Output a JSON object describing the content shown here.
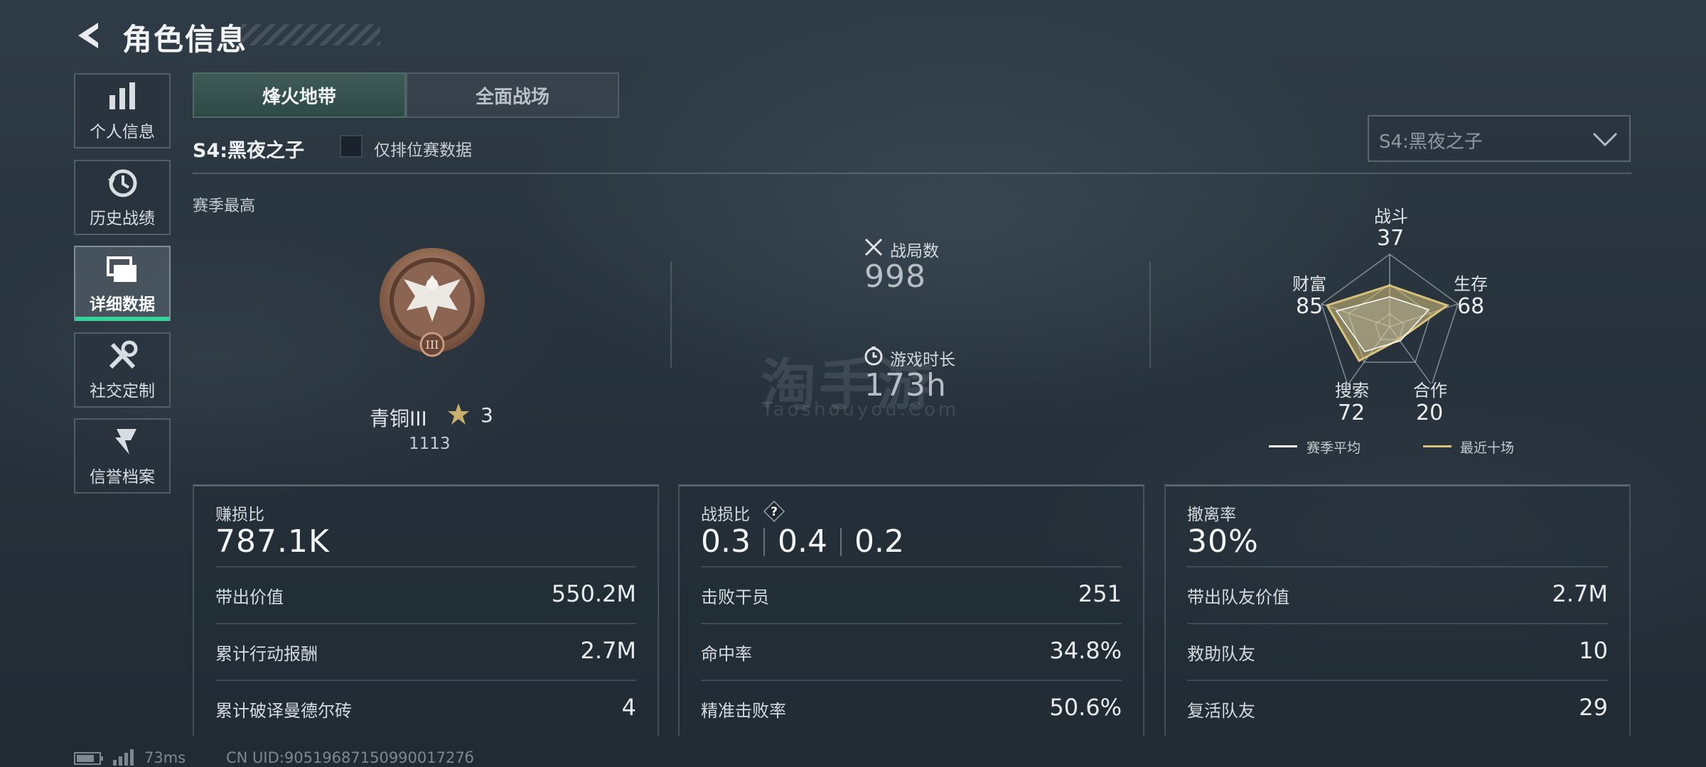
{
  "header": {
    "title": "角色信息"
  },
  "sidebar": {
    "items": [
      {
        "label": "个人信息",
        "icon": "bar-chart-icon"
      },
      {
        "label": "历史战绩",
        "icon": "history-clock-icon"
      },
      {
        "label": "详细数据",
        "icon": "detail-cards-icon",
        "active": true
      },
      {
        "label": "社交定制",
        "icon": "tools-icon"
      },
      {
        "label": "信誉档案",
        "icon": "shield-lightning-icon"
      }
    ]
  },
  "tabs": [
    {
      "label": "烽火地带",
      "active": true
    },
    {
      "label": "全面战场"
    }
  ],
  "season": {
    "name": "S4:黑夜之子",
    "ranked_only_label": "仅排位赛数据",
    "ranked_only_checked": false,
    "dropdown_value": "S4:黑夜之子",
    "best_label": "赛季最高"
  },
  "rank": {
    "name": "青铜III",
    "stars": "3",
    "score": "1113",
    "badge_numeral": "III"
  },
  "stats": {
    "matches_label": "战局数",
    "matches_value": "998",
    "playtime_label": "游戏时长",
    "playtime_value": "173h"
  },
  "watermark": {
    "text": "淘手游",
    "sub": "Taoshouyou.Com"
  },
  "radar": {
    "axes": [
      {
        "label": "战斗",
        "value": "37"
      },
      {
        "label": "生存",
        "value": "68"
      },
      {
        "label": "合作",
        "value": "20"
      },
      {
        "label": "搜索",
        "value": "72"
      },
      {
        "label": "财富",
        "value": "85"
      }
    ],
    "legend": [
      {
        "label": "赛季平均",
        "color": "#ffffff"
      },
      {
        "label": "最近十场",
        "color": "#d8c27a"
      }
    ]
  },
  "cards": [
    {
      "title": "赚损比",
      "big": "787.1K",
      "rows": [
        {
          "k": "带出价值",
          "v": "550.2M"
        },
        {
          "k": "累计行动报酬",
          "v": "2.7M"
        },
        {
          "k": "累计破译曼德尔砖",
          "v": "4"
        }
      ]
    },
    {
      "title": "战损比",
      "triple": [
        "0.3",
        "0.4",
        "0.2"
      ],
      "help": "?",
      "rows": [
        {
          "k": "击败干员",
          "v": "251"
        },
        {
          "k": "命中率",
          "v": "34.8%"
        },
        {
          "k": "精准击败率",
          "v": "50.6%"
        }
      ]
    },
    {
      "title": "撤离率",
      "big": "30%",
      "rows": [
        {
          "k": "带出队友价值",
          "v": "2.7M"
        },
        {
          "k": "救助队友",
          "v": "10"
        },
        {
          "k": "复活队友",
          "v": "29"
        }
      ]
    }
  ],
  "footer": {
    "ping": "73ms",
    "uid": "CN UID:9051968715099001727б"
  },
  "colors": {
    "accent": "#37d19a",
    "gold": "#d8c27a"
  }
}
